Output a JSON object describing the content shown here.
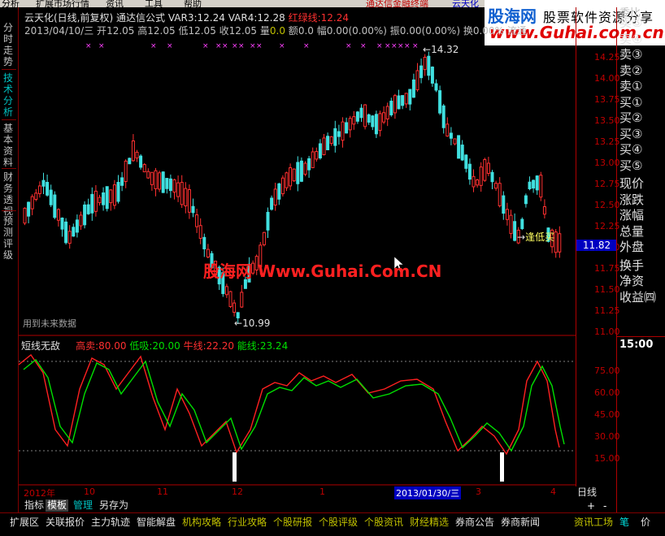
{
  "menubar": {
    "items": [
      "分析",
      "扩展市场行情",
      "资讯",
      "工具",
      "帮助"
    ],
    "ad_text": "通达信金融终端",
    "ad_text2": "云天化"
  },
  "banner": {
    "logo": "股海网",
    "slogan": "股票软件资源分享",
    "url": "www.Guhai.com.cn"
  },
  "left_tabs": [
    {
      "label": "分时走势",
      "active": false
    },
    {
      "label": "技术分析",
      "active": true
    },
    {
      "label": "基本资料",
      "active": false
    },
    {
      "label": "财务透视",
      "active": false
    },
    {
      "label": "预测评级",
      "active": false
    }
  ],
  "header": {
    "stock_name": "云天化(日线,前复权)",
    "formula": "通达信公式",
    "var3_label": "VAR3:",
    "var3": "12.24",
    "var4_label": "VAR4:",
    "var4": "12.28",
    "red_label": "红绿线:",
    "red_value": "12.24",
    "line2_date": "2013/04/10/三",
    "line2_open_label": "开",
    "line2_open": "12.05",
    "line2_high_label": "高",
    "line2_high": "12.05",
    "line2_low_label": "低",
    "line2_low": "12.05",
    "line2_close_label": "收",
    "line2_close": "12.05",
    "line2_vol_label": "量",
    "line2_vol": "0.0",
    "line2_amt_label": "额",
    "line2_amt": "0.0",
    "line2_rng_label": "幅",
    "line2_rng": "0.00(0.00%)",
    "line2_osc_label": "振",
    "line2_osc": "0.00(0.00%)",
    "line2_turn_label": "换",
    "line2_turn": "0.00%",
    "line2_float": "流通"
  },
  "chart_annotations": {
    "high_marker": "14.32",
    "low_marker": "10.99",
    "dip_buy": "逢低买",
    "future_note": "用到未来数据",
    "current_price": "11.82"
  },
  "watermark": "股海网 Www.Guhai.Com.CN",
  "indicator": {
    "name": "短线无敌",
    "high_sell_label": "高卖:",
    "high_sell": "80.00",
    "low_buy_label": "低吸:",
    "low_buy": "20.00",
    "bull_label": "牛线:",
    "bull": "22.20",
    "energy_label": "能线:",
    "energy": "23.24"
  },
  "price_axis": [
    "14.25",
    "14.00",
    "13.75",
    "13.50",
    "13.25",
    "13.00",
    "12.75",
    "12.50",
    "12.25",
    "12.00",
    "11.75",
    "11.50",
    "11.25",
    "11.00"
  ],
  "indicator_axis": [
    "75.00",
    "60.00",
    "45.00",
    "30.00",
    "15.00"
  ],
  "time_axis": {
    "labels": [
      "2012年",
      "10",
      "11",
      "12",
      "1",
      "2013/01/30/三",
      "3",
      "4"
    ],
    "period": "日线"
  },
  "right_panel": {
    "items": [
      "卖⑤",
      "卖④",
      "卖③",
      "卖②",
      "卖①",
      "买①",
      "买②",
      "买③",
      "买④",
      "买⑤",
      "现价",
      "涨跌",
      "涨幅",
      "总量",
      "外盘",
      "换手",
      "净资",
      "收益㈣"
    ],
    "time": "15:00",
    "top_cut": "委比"
  },
  "bottom_tabs": [
    "指标",
    "模板",
    "管理",
    "另存为"
  ],
  "status_bar": {
    "items": [
      "扩展区",
      "关联报价",
      "主力轨迹",
      "智能解盘",
      "机构攻略",
      "行业攻略",
      "个股研报",
      "个股评级",
      "个股资讯",
      "财经精选",
      "券商公告",
      "券商新闻"
    ],
    "right_items": [
      "资讯工场",
      "笔",
      "价"
    ],
    "plus": "+",
    "minus": "-"
  },
  "colors": {
    "up": "#ff3030",
    "down": "#40e0e0",
    "axis": "#b00000",
    "green_line": "#00e000",
    "red_line": "#ff2020"
  }
}
